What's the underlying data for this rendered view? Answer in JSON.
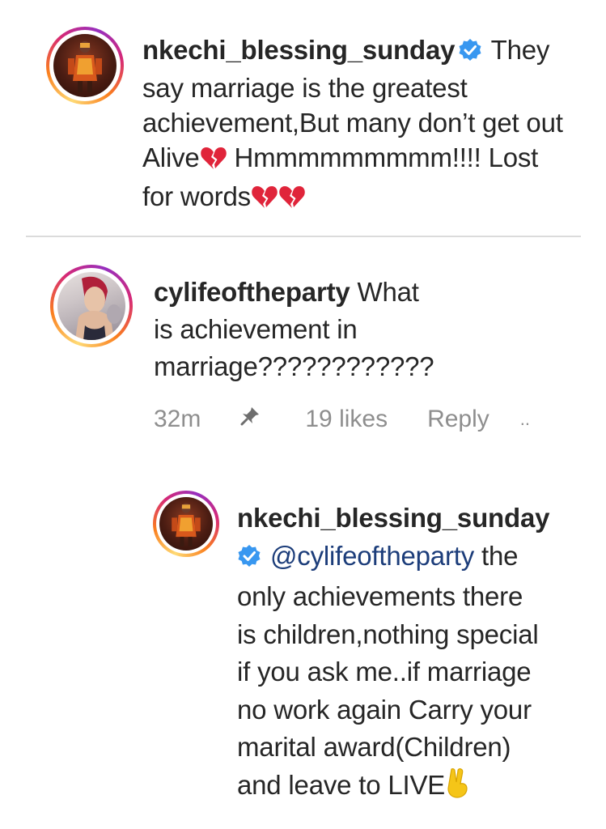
{
  "comments": [
    {
      "username": "nkechi_blessing_sunday",
      "verified": true,
      "avatar": "profile-photo-woman-orange-outfit",
      "text_lines": [
        "They",
        "say marriage is the greatest",
        "achievement,But many don’t get out",
        "Alive",
        " Hmmmmmmmmm!!!! Lost",
        "for words"
      ]
    },
    {
      "username": "cylifeoftheparty",
      "verified": false,
      "avatar": "profile-photo-woman-red-hair",
      "text_lines": [
        "What",
        "is achievement in",
        "marriage????????????"
      ],
      "meta": {
        "time": "32m",
        "pin_icon": "pin-icon",
        "likes": "19 likes",
        "reply": "Reply",
        "more": ".."
      }
    },
    {
      "username": "nkechi_blessing_sunday",
      "verified": true,
      "avatar": "profile-photo-woman-orange-outfit",
      "mention": "@cylifeoftheparty",
      "text_lines": [
        "the",
        "only achievements there",
        "is children,nothing special",
        "if you ask me..if marriage",
        "no work again Carry your",
        "marital award(Children)",
        "and leave to LIVE"
      ]
    }
  ],
  "colors": {
    "text": "#262626",
    "muted": "#8e8e8e",
    "mention": "#1c3d7a",
    "verified": "#3897f0",
    "divider": "#dbdbdb"
  }
}
